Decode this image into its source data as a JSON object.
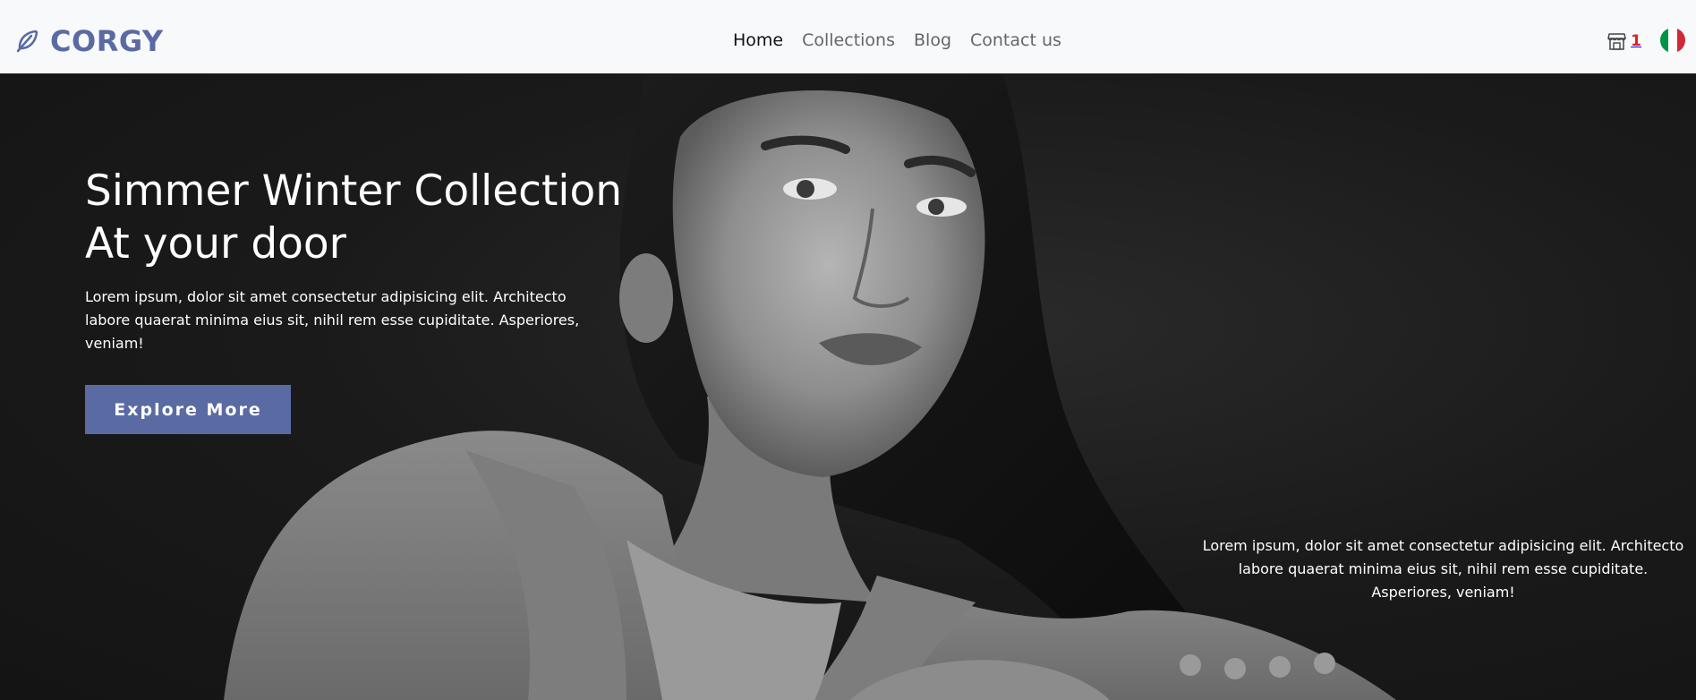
{
  "brand": {
    "name": "CORGY",
    "logo_icon": "feather-icon",
    "color": "#5a6aa3"
  },
  "nav": {
    "links": [
      {
        "label": "Home",
        "active": true
      },
      {
        "label": "Collections",
        "active": false
      },
      {
        "label": "Blog",
        "active": false
      },
      {
        "label": "Contact us",
        "active": false
      }
    ]
  },
  "store": {
    "icon": "store-icon",
    "count": "1",
    "count_color": "#e0211b"
  },
  "locale": {
    "icon": "italy-flag-icon",
    "colors": [
      "#009246",
      "#ffffff",
      "#ce2b37"
    ]
  },
  "hero": {
    "title_line1": "Simmer Winter Collection",
    "title_line2": "At your door",
    "description": "Lorem ipsum, dolor sit amet consectetur adipisicing elit. Architecto labore quaerat minima eius sit, nihil rem esse cupiditate. Asperiores, veniam!",
    "cta_label": "Explore More",
    "cta_color": "#5a6aa3",
    "side_description": "Lorem ipsum, dolor sit amet consectetur adipisicing elit. Architecto labore quaerat minima eius sit, nihil rem esse cupiditate. Asperiores, veniam!"
  }
}
